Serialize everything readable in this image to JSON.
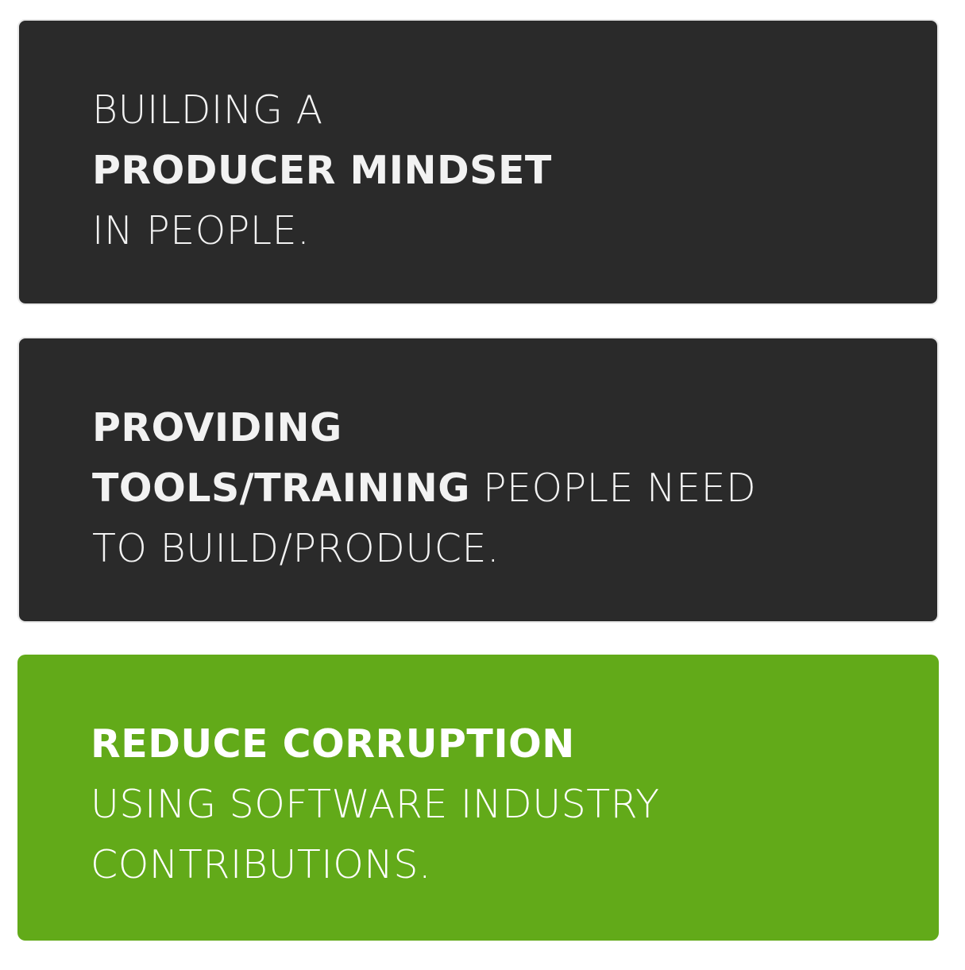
{
  "colors": {
    "page_background": "#ffffff",
    "dark_card": "#2a2a2a",
    "green_card": "#62aa19",
    "text_light": "#f2f2f2",
    "text_white": "#ffffff"
  },
  "cards": [
    {
      "style": "dark",
      "lines": [
        {
          "regular_before": "BUILDING A",
          "bold": "",
          "regular_after": ""
        },
        {
          "regular_before": "",
          "bold": "PRODUCER MINDSET",
          "regular_after": ""
        },
        {
          "regular_before": "IN PEOPLE.",
          "bold": "",
          "regular_after": ""
        }
      ]
    },
    {
      "style": "dark",
      "lines": [
        {
          "regular_before": "",
          "bold": "PROVIDING",
          "regular_after": ""
        },
        {
          "regular_before": "",
          "bold": "TOOLS/TRAINING",
          "regular_after": " PEOPLE NEED"
        },
        {
          "regular_before": "TO BUILD/PRODUCE.",
          "bold": "",
          "regular_after": ""
        }
      ]
    },
    {
      "style": "green",
      "lines": [
        {
          "regular_before": "",
          "bold": "REDUCE CORRUPTION",
          "regular_after": ""
        },
        {
          "regular_before": "USING SOFTWARE INDUSTRY",
          "bold": "",
          "regular_after": ""
        },
        {
          "regular_before": "CONTRIBUTIONS.",
          "bold": "",
          "regular_after": ""
        }
      ]
    }
  ]
}
